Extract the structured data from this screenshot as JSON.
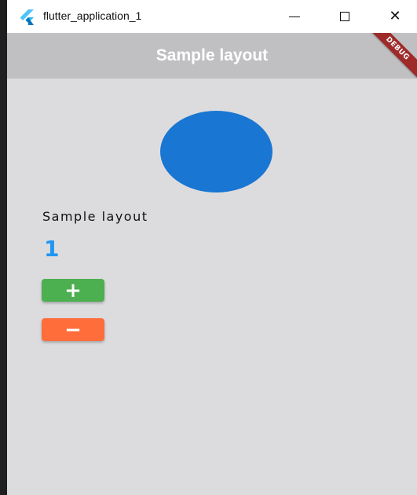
{
  "window": {
    "title": "flutter_application_1",
    "controls": {
      "minimize_icon": "minimize-icon",
      "maximize_icon": "maximize-icon",
      "close_icon": "close-icon",
      "close_glyph": "✕"
    }
  },
  "appbar": {
    "title": "Sample layout",
    "debug_banner": "DEBUG",
    "background": "#c0c0c2"
  },
  "content": {
    "circle_color": "#1976d2",
    "label": "Sample layout",
    "counter": "1",
    "counter_color": "#2196f3",
    "increment_label": "+",
    "increment_color": "#4caf50",
    "decrement_label": "−",
    "decrement_color": "#ff6d3a"
  }
}
